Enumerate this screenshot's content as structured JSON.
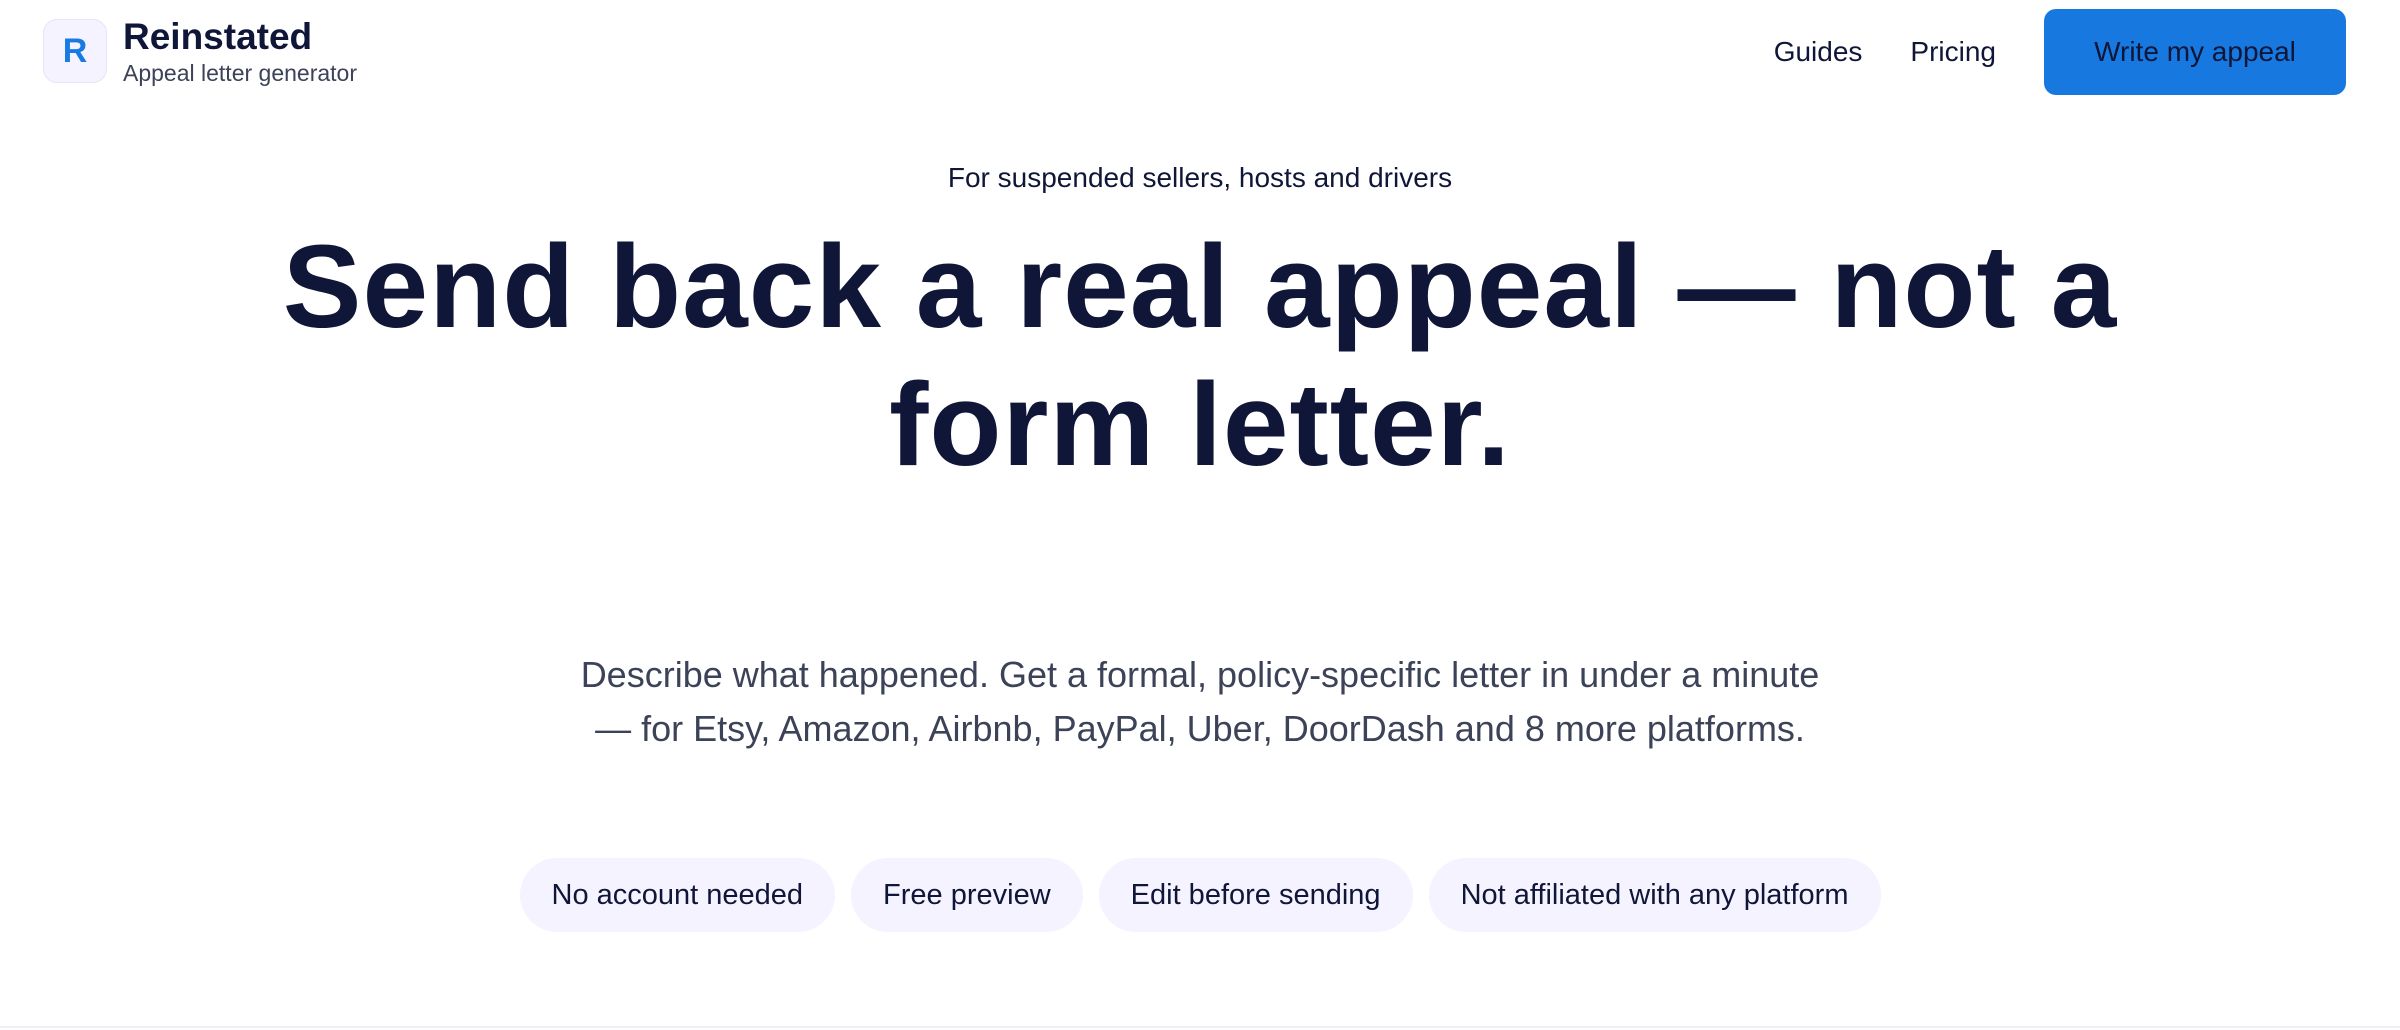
{
  "brand": {
    "logo_letter": "R",
    "name": "Reinstated",
    "tagline": "Appeal letter generator"
  },
  "nav": {
    "links": [
      "Guides",
      "Pricing"
    ],
    "cta_label": "Write my appeal"
  },
  "hero": {
    "eyebrow": "For suspended sellers, hosts and drivers",
    "headline": "Send back a real appeal — not a form letter.",
    "subcopy": "Describe what happened. Get a formal, policy-specific letter in under a minute — for Etsy, Amazon, Airbnb, PayPal, Uber, DoorDash and 8 more platforms.",
    "pills": [
      "No account needed",
      "Free preview",
      "Edit before sending",
      "Not affiliated with any platform"
    ]
  },
  "colors": {
    "primary": "#1778e0",
    "text_dark": "#0f1638",
    "text_muted": "#3c4257",
    "pill_bg": "#f4f3ff"
  }
}
